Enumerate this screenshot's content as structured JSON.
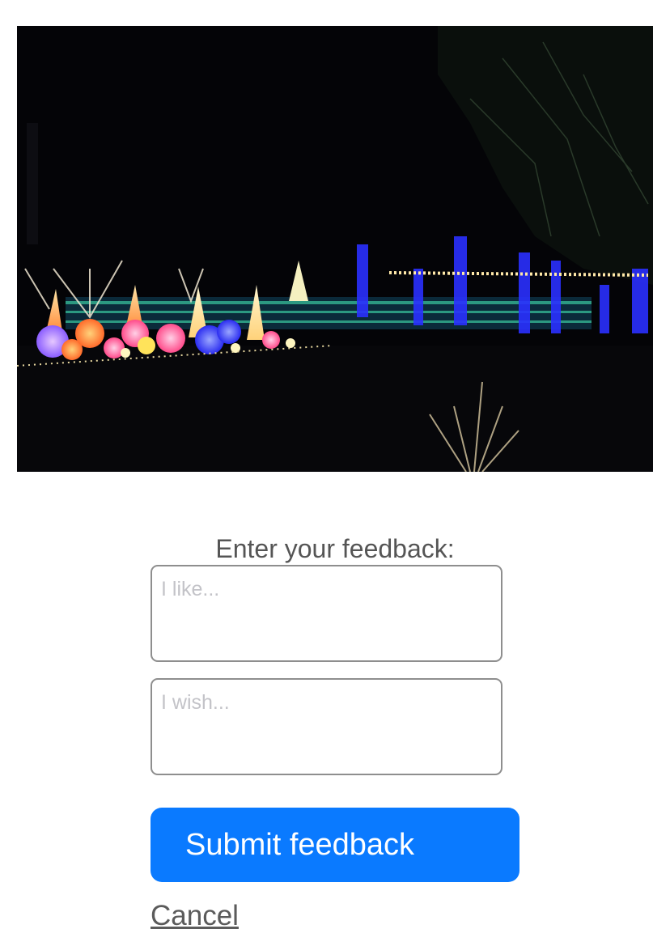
{
  "photo": {
    "description_icon": "photo-icon"
  },
  "feedback": {
    "prompt": "Enter your feedback:",
    "like_placeholder": "I like...",
    "like_value": "",
    "wish_placeholder": "I wish...",
    "wish_value": "",
    "submit_label": "Submit feedback",
    "cancel_label": "Cancel"
  },
  "colors": {
    "accent": "#0a7aff",
    "prompt_text": "#555555",
    "field_border": "#8e8e8e",
    "placeholder": "#c3c3c8"
  }
}
